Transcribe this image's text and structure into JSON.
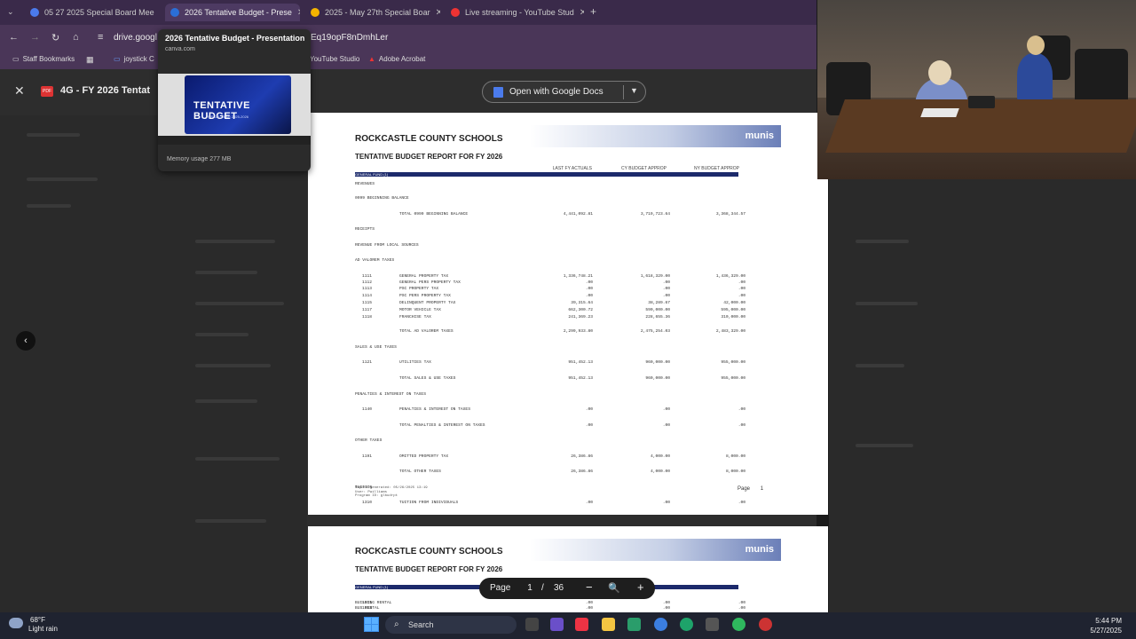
{
  "browser": {
    "tabs": [
      {
        "label": "05 27 2025 Special Board Mee",
        "color": "#4b7bec"
      },
      {
        "label": "2026 Tentative Budget - Prese",
        "color": "#2b6fd6"
      },
      {
        "label": "2025 - May 27th Special Boar",
        "color": "#f4b400"
      },
      {
        "label": "Live streaming - YouTube Stud",
        "color": "#e33"
      }
    ],
    "address_left": "drive.googl",
    "address_right": "Eq19opF8nDmhLer",
    "bookmarks": [
      "Staff Bookmarks",
      "joystick C",
      "YouTube Studio",
      "Adobe Acrobat"
    ],
    "tooltip": {
      "title": "2026 Tentative Budget - Presentation",
      "domain": "canva.com",
      "slide_title": "TENTATIVE BUDGET",
      "slide_sub": "FISCAL YEAR 2025-2026",
      "memory": "Memory usage 277 MB"
    }
  },
  "viewer": {
    "filename": "4G - FY 2026 Tentat",
    "open_button": "Open with Google Docs",
    "page_label": "Page",
    "page_current": "1",
    "page_sep": "/",
    "page_total": "36"
  },
  "document": {
    "school": "ROCKCASTLE COUNTY SCHOOLS",
    "report": "TENTATIVE BUDGET REPORT FOR FY 2026",
    "brand": "munis",
    "fund": "GENERAL FUND (1)",
    "col1": "LAST FY ACTUALS",
    "col2": "CY BUDGET APPROP",
    "col3": "NY BUDGET APPROP",
    "rows": [
      {
        "acct": "",
        "desc": "REVENUES",
        "a": "",
        "b": "",
        "c": "",
        "indent": 0
      },
      {
        "acct": "",
        "desc": "0999 BEGINNING BALANCE",
        "a": "",
        "b": "",
        "c": "",
        "indent": 0
      },
      {
        "acct": "",
        "desc": "TOTAL 0999 BEGINNING BALANCE",
        "a": "4,441,092.81",
        "b": "3,719,723.64",
        "c": "3,368,344.57",
        "indent": 2
      },
      {
        "acct": "",
        "desc": "RECEIPTS",
        "a": "",
        "b": "",
        "c": "",
        "indent": 0
      },
      {
        "acct": "",
        "desc": "REVENUE FROM LOCAL SOURCES",
        "a": "",
        "b": "",
        "c": "",
        "indent": 0
      },
      {
        "acct": "",
        "desc": "AD VALOREM TAXES",
        "a": "",
        "b": "",
        "c": "",
        "indent": 0
      },
      {
        "acct": "1111",
        "desc": "GENERAL PROPERTY TAX",
        "a": "1,336,748.21",
        "b": "1,618,329.00",
        "c": "1,436,329.00",
        "indent": 2
      },
      {
        "acct": "1112",
        "desc": "GENERAL PERS PROPERTY TAX",
        "a": ".00",
        "b": ".00",
        "c": ".00",
        "indent": 2
      },
      {
        "acct": "1113",
        "desc": "PSC PROPERTY TAX",
        "a": ".00",
        "b": ".00",
        "c": ".00",
        "indent": 2
      },
      {
        "acct": "1114",
        "desc": "PSC PERS PROPERTY TAX",
        "a": ".00",
        "b": ".00",
        "c": ".00",
        "indent": 2
      },
      {
        "acct": "1115",
        "desc": "DELINQUENT PROPERTY TAX",
        "a": "39,315.64",
        "b": "38,289.67",
        "c": "42,000.00",
        "indent": 2
      },
      {
        "acct": "1117",
        "desc": "MOTOR VEHICLE TAX",
        "a": "662,300.72",
        "b": "590,000.00",
        "c": "595,000.00",
        "indent": 2
      },
      {
        "acct": "1118",
        "desc": "FRANCHISE TAX",
        "a": "241,369.23",
        "b": "228,655.36",
        "c": "310,000.00",
        "indent": 2
      },
      {
        "acct": "",
        "desc": "TOTAL AD VALOREM TAXES",
        "a": "2,299,933.80",
        "b": "2,475,254.03",
        "c": "2,483,329.00",
        "indent": 2
      },
      {
        "acct": "",
        "desc": "SALES & USE TAXES",
        "a": "",
        "b": "",
        "c": "",
        "indent": 0
      },
      {
        "acct": "1121",
        "desc": "UTILITIES TAX",
        "a": "951,452.13",
        "b": "960,000.00",
        "c": "955,000.00",
        "indent": 2
      },
      {
        "acct": "",
        "desc": "TOTAL SALES & USE TAXES",
        "a": "951,452.13",
        "b": "960,000.00",
        "c": "955,000.00",
        "indent": 2
      },
      {
        "acct": "",
        "desc": "PENALTIES & INTEREST ON TAXES",
        "a": "",
        "b": "",
        "c": "",
        "indent": 0
      },
      {
        "acct": "1140",
        "desc": "PENALTIES & INTEREST ON TAXES",
        "a": ".00",
        "b": ".00",
        "c": ".00",
        "indent": 2
      },
      {
        "acct": "",
        "desc": "TOTAL PENALTIES & INTEREST ON TAXES",
        "a": ".00",
        "b": ".00",
        "c": ".00",
        "indent": 2
      },
      {
        "acct": "",
        "desc": "OTHER TAXES",
        "a": "",
        "b": "",
        "c": "",
        "indent": 0
      },
      {
        "acct": "1191",
        "desc": "OMITTED PROPERTY TAX",
        "a": "26,386.86",
        "b": "4,000.00",
        "c": "8,000.00",
        "indent": 2
      },
      {
        "acct": "",
        "desc": "TOTAL OTHER TAXES",
        "a": "26,386.86",
        "b": "4,000.00",
        "c": "8,000.00",
        "indent": 2
      },
      {
        "acct": "",
        "desc": "TUITION",
        "a": "",
        "b": "",
        "c": "",
        "indent": 0
      },
      {
        "acct": "1310",
        "desc": "TUITION FROM INDIVIDUALS",
        "a": ".00",
        "b": ".00",
        "c": ".00",
        "indent": 2
      },
      {
        "acct": "",
        "desc": "TOTAL TUITION",
        "a": ".00",
        "b": ".00",
        "c": ".00",
        "indent": 2
      },
      {
        "acct": "",
        "desc": "EARNINGS ON INVESTMENTS",
        "a": "",
        "b": "",
        "c": "",
        "indent": 0
      },
      {
        "acct": "1510",
        "desc": "INTEREST ON INVESTMENTS",
        "a": "407,818.91",
        "b": "420,000.00",
        "c": "425,000.00",
        "indent": 2
      },
      {
        "acct": "",
        "desc": "TOTAL EARNINGS ON INVESTMENTS",
        "a": "407,818.91",
        "b": "420,000.00",
        "c": "425,000.00",
        "indent": 2
      },
      {
        "acct": "",
        "desc": "OTHER REVENUE FROM LOCAL SOURCES",
        "a": "",
        "b": "",
        "c": "",
        "indent": 0
      }
    ],
    "footer": [
      "Report generated: 05/26/2025 13:19",
      "User: Pwilliams",
      "Program ID: glbudrpt"
    ],
    "page_word": "Page",
    "page_no": "1",
    "page2_rows": [
      {
        "acct": "1911",
        "desc": "BUILDING RENTAL",
        "a": ".00",
        "b": ".00",
        "c": ".00"
      },
      {
        "acct": "1912",
        "desc": "BUS RENTAL",
        "a": ".00",
        "b": ".00",
        "c": ".00"
      }
    ]
  },
  "taskbar": {
    "weather_temp": "68°F",
    "weather_desc": "Light rain",
    "search": "Search",
    "time": "5:44 PM",
    "date": "5/27/2025"
  }
}
